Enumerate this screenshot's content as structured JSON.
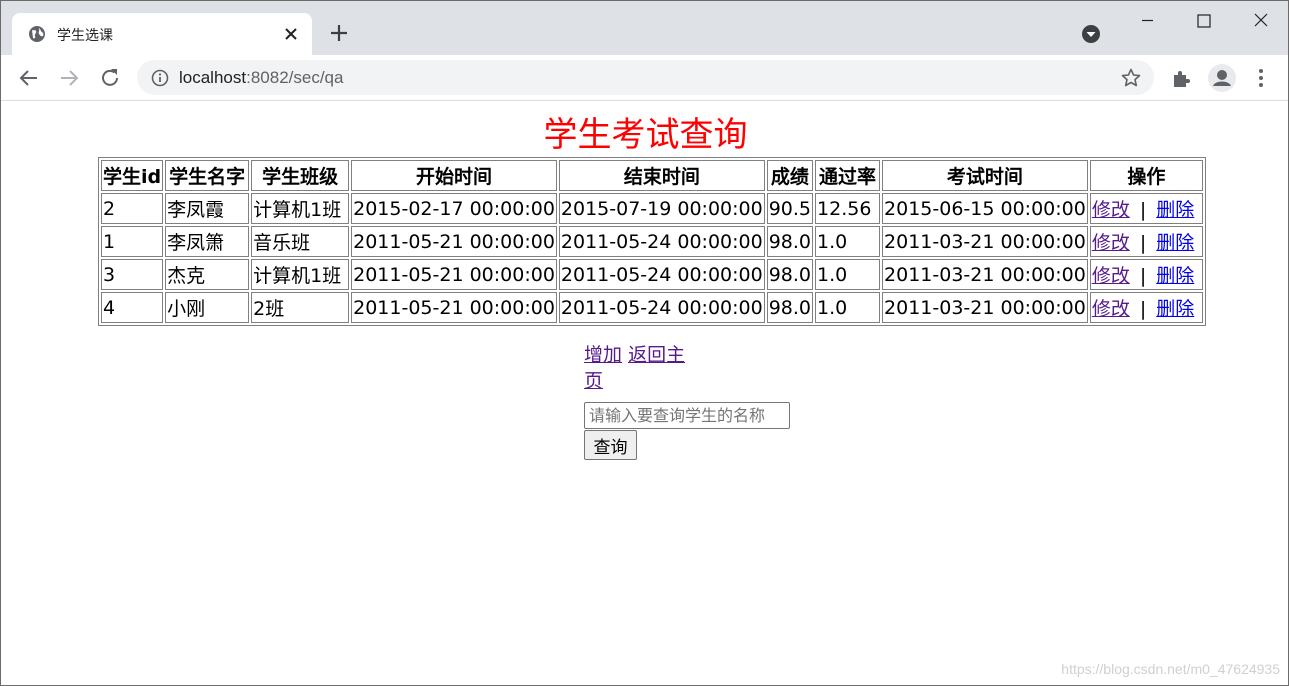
{
  "browser": {
    "tab_title": "学生选课",
    "url_host": "localhost",
    "url_rest": ":8082/sec/qa"
  },
  "page": {
    "title": "学生考试查询",
    "headers": [
      "学生id",
      "学生名字",
      "学生班级",
      "开始时间",
      "结束时间",
      "成绩",
      "通过率",
      "考试时间",
      "操作"
    ],
    "rows": [
      {
        "id": "2",
        "name": "李凤霞",
        "class": "计算机1班",
        "start": "2015-02-17 00:00:00",
        "end": "2015-07-19 00:00:00",
        "score": "90.5",
        "rate": "12.56",
        "exam": "2015-06-15 00:00:00"
      },
      {
        "id": "1",
        "name": "李凤箫",
        "class": "音乐班",
        "start": "2011-05-21 00:00:00",
        "end": "2011-05-24 00:00:00",
        "score": "98.0",
        "rate": "1.0",
        "exam": "2011-03-21 00:00:00"
      },
      {
        "id": "3",
        "name": "杰克",
        "class": "计算机1班",
        "start": "2011-05-21 00:00:00",
        "end": "2011-05-24 00:00:00",
        "score": "98.0",
        "rate": "1.0",
        "exam": "2011-03-21 00:00:00"
      },
      {
        "id": "4",
        "name": "小刚",
        "class": "2班",
        "start": "2011-05-21 00:00:00",
        "end": "2011-05-24 00:00:00",
        "score": "98.0",
        "rate": "1.0",
        "exam": "2011-03-21 00:00:00"
      }
    ],
    "edit_label": "修改",
    "op_separator": "|",
    "delete_label": "删除",
    "add_label": "增加",
    "home_label": "返回主页",
    "search_placeholder": "请输入要查询学生的名称",
    "search_button": "查询",
    "watermark": "https://blog.csdn.net/m0_47624935"
  },
  "colors": {
    "title": "#ff0000",
    "link": "#0000ee",
    "visited_link": "#551a8b"
  }
}
